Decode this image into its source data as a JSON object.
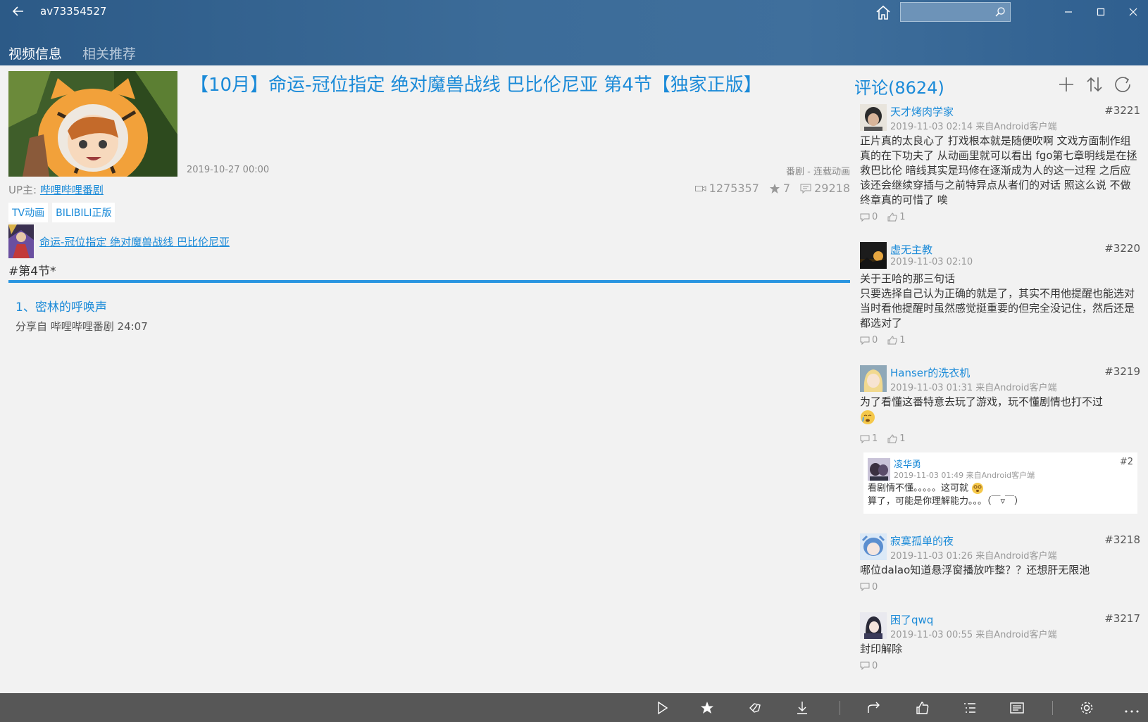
{
  "window": {
    "title": "av73354527"
  },
  "search": {
    "placeholder": "",
    "value": ""
  },
  "tabs": [
    {
      "label": "视频信息",
      "active": true
    },
    {
      "label": "相关推荐",
      "active": false
    }
  ],
  "video": {
    "title": "【10月】命运-冠位指定 绝对魔兽战线 巴比伦尼亚 第4节【独家正版】",
    "pub_date": "2019-10-27 00:00",
    "category": "番剧 - 连载动画",
    "up_label": "UP主:",
    "up_name": "哔哩哔哩番剧",
    "views": "1275357",
    "favorites": "7",
    "danmaku": "29218",
    "tags": [
      "TV动画",
      "BILIBILI正版"
    ],
    "bangumi_link": "命运-冠位指定 绝对魔兽战线 巴比伦尼亚",
    "episode_tag": "#第4节*",
    "parts": [
      {
        "title": "1、密林的呼唤声",
        "info": "分享自 哔哩哔哩番剧 24:07"
      }
    ]
  },
  "comments": {
    "title": "评论(8624)",
    "items": [
      {
        "user": "天才烤肉学家",
        "floor": "#3221",
        "meta": "2019-11-03 02:14 来自Android客户端",
        "text": "正片真的太良心了 打戏根本就是随便吹啊 文戏方面制作组真的在下功夫了 从动画里就可以看出 fgo第七章明线是在拯救巴比伦 暗线其实是玛修在逐渐成为人的这一过程 之后应该还会继续穿插与之前特异点从者们的对话 照这么说 不做终章真的可惜了 唉",
        "replies": "0",
        "likes": "1"
      },
      {
        "user": "虚无主教",
        "floor": "#3220",
        "meta": "2019-11-03 02:10",
        "text": "关于王哈的那三句话\n只要选择自己认为正确的就是了，其实不用他提醒也能选对\n当时看他提醒时虽然感觉挺重要的但完全没记住，然后还是都选对了",
        "replies": "0",
        "likes": "1"
      },
      {
        "user": "Hanser的洗衣机",
        "floor": "#3219",
        "meta": "2019-11-03 01:31 来自Android客户端",
        "text": "为了看懂这番特意去玩了游戏，玩不懂剧情也打不过",
        "replies": "1",
        "likes": "1",
        "reply": {
          "user": "凌华勇",
          "floor": "#2",
          "meta": "2019-11-03 01:49 来自Android客户端",
          "line1": "看剧情不懂。。。。。这可就",
          "line2": "算了，可能是你理解能力。。。（￣▿￣）"
        }
      },
      {
        "user": "寂寞孤单的夜",
        "floor": "#3218",
        "meta": "2019-11-03 01:26 来自Android客户端",
        "text": "哪位dalao知道悬浮窗播放咋整？？还想肝无限池",
        "replies": "0"
      },
      {
        "user": "困了qwq",
        "floor": "#3217",
        "meta": "2019-11-03 00:55 来自Android客户端",
        "text": "封印解除",
        "replies": "0"
      }
    ]
  },
  "icons": {
    "back": "back-arrow-icon",
    "home": "home-icon",
    "search": "search-icon",
    "minimize": "minimize-icon",
    "maximize": "maximize-icon",
    "close": "close-icon",
    "add": "add-icon",
    "sort": "sort-icon",
    "refresh": "refresh-icon",
    "appbar": [
      "play-icon",
      "favorite-star-icon",
      "coin-icon",
      "download-icon",
      "share-icon",
      "like-icon",
      "playlist-icon",
      "danmaku-icon",
      "settings-icon",
      "more-icon"
    ]
  },
  "colors": {
    "accent": "#1a8ad8",
    "header": "#2c5a87",
    "appbar": "#575757",
    "divider": "#2a95e0"
  }
}
